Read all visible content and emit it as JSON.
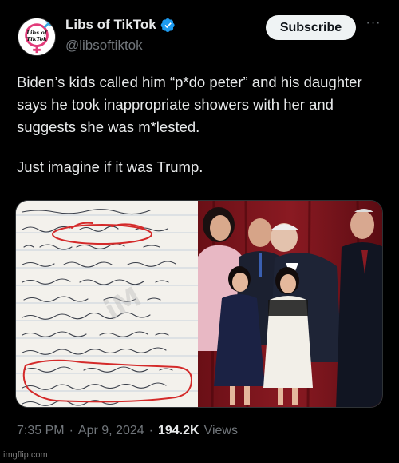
{
  "author": {
    "display_name": "Libs of TikTok",
    "handle": "@libsoftiktok",
    "avatar_text_line1": "Libs of",
    "avatar_text_line2": "TikTok"
  },
  "subscribe_label": "Subscribe",
  "more_label": "···",
  "tweet": {
    "paragraph1": "Biden’s kids called him “p*do peter” and his daughter says he took inappropriate showers with her and suggests she was m*lested.",
    "paragraph2": "Just imagine if it was Trump."
  },
  "media": {
    "left_image": "handwritten-diary-page",
    "right_image": "photo-man-with-children"
  },
  "meta": {
    "time": "7:35 PM",
    "separator": "·",
    "date": "Apr 9, 2024",
    "views_count": "194.2K",
    "views_label": "Views"
  },
  "watermark": "imgflip.com",
  "colors": {
    "background": "#000000",
    "text_primary": "#e7e9ea",
    "text_secondary": "#71767b",
    "verified": "#1d9bf0",
    "subscribe_bg": "#eff3f4"
  }
}
